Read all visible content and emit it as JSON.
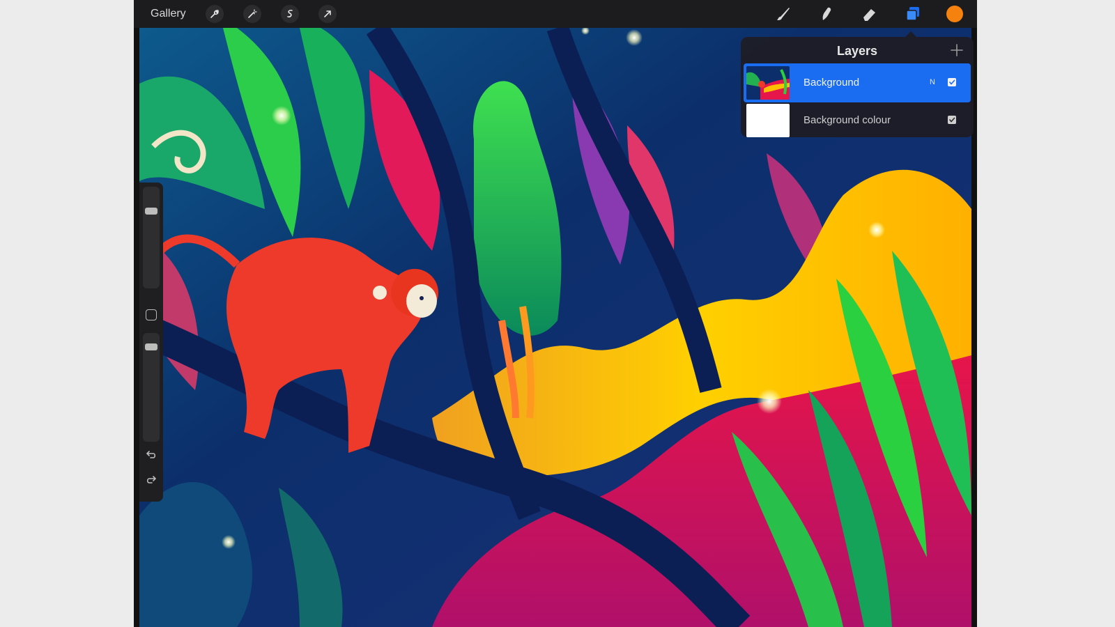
{
  "toolbar": {
    "gallery_label": "Gallery",
    "left_tools": [
      "wrench-icon",
      "magic-wand-icon",
      "selection-icon",
      "transform-arrow-icon"
    ],
    "right_tools": [
      "brush-icon",
      "smudge-icon",
      "eraser-icon",
      "layers-icon"
    ],
    "current_color": "#f5820f",
    "active_tool_color": "#1a6cf0"
  },
  "layers_panel": {
    "title": "Layers",
    "add_icon": "plus-icon",
    "layers": [
      {
        "name": "Background",
        "blend_mode": "N",
        "visible": true,
        "selected": true
      },
      {
        "name": "Background colour",
        "blend_mode": "",
        "visible": true,
        "selected": false
      }
    ]
  },
  "sidebar": {
    "brush_size": 0.78,
    "opacity": 0.9,
    "undo_icon": "undo-icon",
    "redo_icon": "redo-icon",
    "modify_icon": "square-icon"
  },
  "artwork": {
    "subject": "jungle-illustration-with-red-monkey"
  }
}
